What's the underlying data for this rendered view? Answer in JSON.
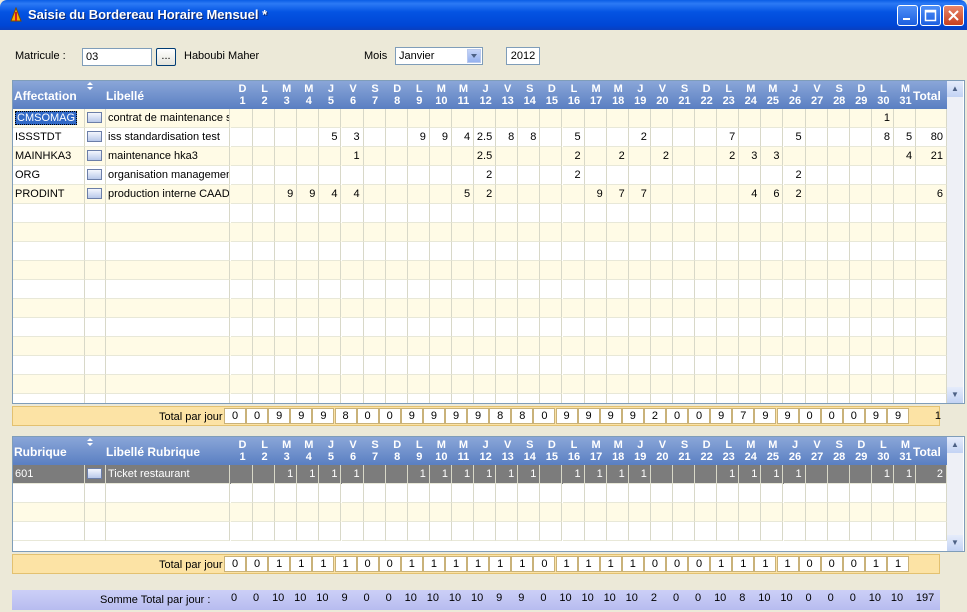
{
  "window": {
    "title": "Saisie du Bordereau Horaire Mensuel *"
  },
  "form": {
    "matricule_label": "Matricule :",
    "matricule_value": "03",
    "lookup_label": "...",
    "employee_name": "Haboubi Maher",
    "mois_label": "Mois",
    "mois_value": "Janvier",
    "year_value": "2012"
  },
  "days": [
    {
      "l": "D",
      "n": "1"
    },
    {
      "l": "L",
      "n": "2"
    },
    {
      "l": "M",
      "n": "3"
    },
    {
      "l": "M",
      "n": "4"
    },
    {
      "l": "J",
      "n": "5"
    },
    {
      "l": "V",
      "n": "6"
    },
    {
      "l": "S",
      "n": "7"
    },
    {
      "l": "D",
      "n": "8"
    },
    {
      "l": "L",
      "n": "9"
    },
    {
      "l": "M",
      "n": "10"
    },
    {
      "l": "M",
      "n": "11"
    },
    {
      "l": "J",
      "n": "12"
    },
    {
      "l": "V",
      "n": "13"
    },
    {
      "l": "S",
      "n": "14"
    },
    {
      "l": "D",
      "n": "15"
    },
    {
      "l": "L",
      "n": "16"
    },
    {
      "l": "M",
      "n": "17"
    },
    {
      "l": "M",
      "n": "18"
    },
    {
      "l": "J",
      "n": "19"
    },
    {
      "l": "V",
      "n": "20"
    },
    {
      "l": "S",
      "n": "21"
    },
    {
      "l": "D",
      "n": "22"
    },
    {
      "l": "L",
      "n": "23"
    },
    {
      "l": "M",
      "n": "24"
    },
    {
      "l": "M",
      "n": "25"
    },
    {
      "l": "J",
      "n": "26"
    },
    {
      "l": "V",
      "n": "27"
    },
    {
      "l": "S",
      "n": "28"
    },
    {
      "l": "D",
      "n": "29"
    },
    {
      "l": "L",
      "n": "30"
    },
    {
      "l": "M",
      "n": "31"
    }
  ],
  "grid1": {
    "col_affectation": "Affectation",
    "col_libelle": "Libellé",
    "col_total": "Total",
    "rows": [
      {
        "code": "CMSOMAG",
        "label": "contrat de maintenance sc",
        "vals": [
          "",
          "",
          "",
          "",
          "",
          "",
          "",
          "",
          "",
          "",
          "",
          "",
          "",
          "",
          "",
          "",
          "",
          "",
          "",
          "",
          "",
          "",
          "",
          "",
          "",
          "",
          "",
          "",
          "",
          "1",
          ""
        ],
        "total": ""
      },
      {
        "code": "ISSSTDT",
        "label": "iss standardisation  test",
        "vals": [
          "",
          "",
          "",
          "",
          "5",
          "3",
          "",
          "",
          "9",
          "9",
          "4",
          "2.5",
          "8",
          "8",
          "",
          "5",
          "",
          "",
          "2",
          "",
          "",
          "",
          "7",
          "",
          "",
          "5",
          "",
          "",
          "",
          "8",
          "5"
        ],
        "total": "80"
      },
      {
        "code": "MAINHKA3",
        "label": "maintenance hka3",
        "vals": [
          "",
          "",
          "",
          "",
          "",
          "1",
          "",
          "",
          "",
          "",
          "",
          "2.5",
          "",
          "",
          "",
          "2",
          "",
          "2",
          "",
          "2",
          "",
          "",
          "2",
          "3",
          "3",
          "",
          "",
          "",
          "",
          "",
          "4"
        ],
        "total": "21"
      },
      {
        "code": "ORG",
        "label": "organisation management",
        "vals": [
          "",
          "",
          "",
          "",
          "",
          "",
          "",
          "",
          "",
          "",
          "",
          "2",
          "",
          "",
          "",
          "2",
          "",
          "",
          "",
          "",
          "",
          "",
          "",
          "",
          "",
          "2",
          "",
          "",
          "",
          "",
          ""
        ],
        "total": ""
      },
      {
        "code": "PRODINT",
        "label": "production interne CAAD",
        "vals": [
          "",
          "",
          "9",
          "9",
          "4",
          "4",
          "",
          "",
          "",
          "",
          "5",
          "2",
          "",
          "",
          "",
          "",
          "9",
          "7",
          "7",
          "",
          "",
          "",
          "",
          "4",
          "6",
          "2",
          "",
          "",
          "",
          "",
          ""
        ],
        "total": "6"
      }
    ],
    "total_label": "Total par jour :",
    "totals": [
      "0",
      "0",
      "9",
      "9",
      "9",
      "8",
      "0",
      "0",
      "9",
      "9",
      "9",
      "9",
      "8",
      "8",
      "0",
      "9",
      "9",
      "9",
      "9",
      "2",
      "0",
      "0",
      "9",
      "7",
      "9",
      "9",
      "0",
      "0",
      "0",
      "9",
      "9"
    ],
    "grand_total": "1"
  },
  "grid2": {
    "col_rubrique": "Rubrique",
    "col_libelle": "Libellé Rubrique",
    "col_total": "Total",
    "rows": [
      {
        "code": "601",
        "label": "Ticket restaurant",
        "vals": [
          "",
          "",
          "1",
          "1",
          "1",
          "1",
          "",
          "",
          "1",
          "1",
          "1",
          "1",
          "1",
          "1",
          "",
          "1",
          "1",
          "1",
          "1",
          "",
          "",
          "",
          "1",
          "1",
          "1",
          "1",
          "",
          "",
          "",
          "1",
          "1"
        ],
        "total": "2"
      }
    ],
    "total_label": "Total par jour :",
    "totals": [
      "0",
      "0",
      "1",
      "1",
      "1",
      "1",
      "0",
      "0",
      "1",
      "1",
      "1",
      "1",
      "1",
      "1",
      "0",
      "1",
      "1",
      "1",
      "1",
      "0",
      "0",
      "0",
      "1",
      "1",
      "1",
      "1",
      "0",
      "0",
      "0",
      "1",
      "1"
    ],
    "grand_total": ""
  },
  "summary": {
    "label": "Somme Total par jour :",
    "totals": [
      "0",
      "0",
      "10",
      "10",
      "10",
      "9",
      "0",
      "0",
      "10",
      "10",
      "10",
      "10",
      "9",
      "9",
      "0",
      "10",
      "10",
      "10",
      "10",
      "2",
      "0",
      "0",
      "10",
      "8",
      "10",
      "10",
      "0",
      "0",
      "0",
      "10",
      "10"
    ],
    "grand_total": "197"
  },
  "colors": {
    "titlebar": "#0454e3",
    "header": "#5a7fc2",
    "row_alt": "#fffbe6",
    "total_bar": "#fce3a5",
    "selected_row": "#7c7c7c"
  }
}
